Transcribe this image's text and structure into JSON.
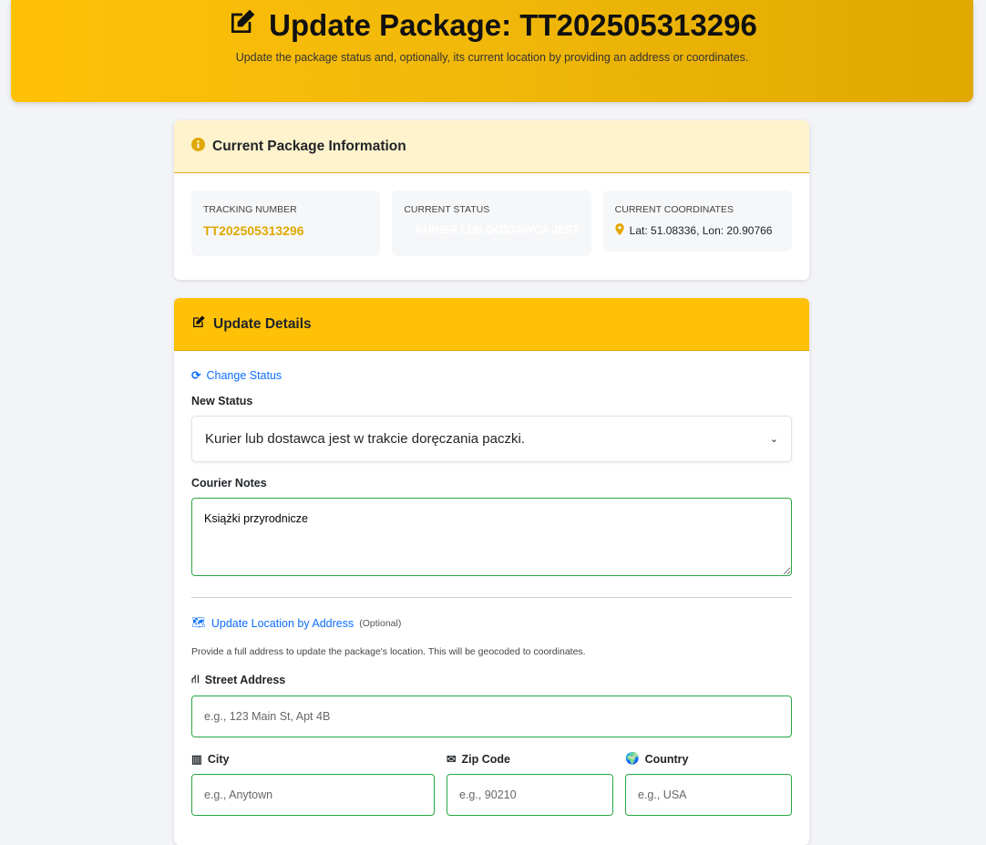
{
  "header": {
    "title": "Update Package: TT202505313296",
    "subtitle": "Update the package status and, optionally, its current location by providing an address or coordinates."
  },
  "info": {
    "title": "Current Package Information",
    "tracking_label": "Tracking Number",
    "tracking_value": "TT202505313296",
    "status_label": "Current Status",
    "status_value": "KURIER LUB DOSTAWCA JEST",
    "coords_label": "Current Coordinates",
    "coords_value": "Lat: 51.08336, Lon: 20.90766"
  },
  "update": {
    "title": "Update Details",
    "change_status": "Change Status",
    "new_status_label": "New Status",
    "new_status_value": "Kurier lub dostawca jest w trakcie doręczania paczki.",
    "notes_label": "Courier Notes",
    "notes_value": "Książki przyrodnicze",
    "address_title": "Update Location by Address",
    "optional": "(Optional)",
    "address_help": "Provide a full address to update the package's location. This will be geocoded to coordinates.",
    "street_label": "Street Address",
    "street_placeholder": "e.g., 123 Main St, Apt 4B",
    "city_label": "City",
    "city_placeholder": "e.g., Anytown",
    "zip_label": "Zip Code",
    "zip_placeholder": "e.g., 90210",
    "country_label": "Country",
    "country_placeholder": "e.g., USA"
  }
}
